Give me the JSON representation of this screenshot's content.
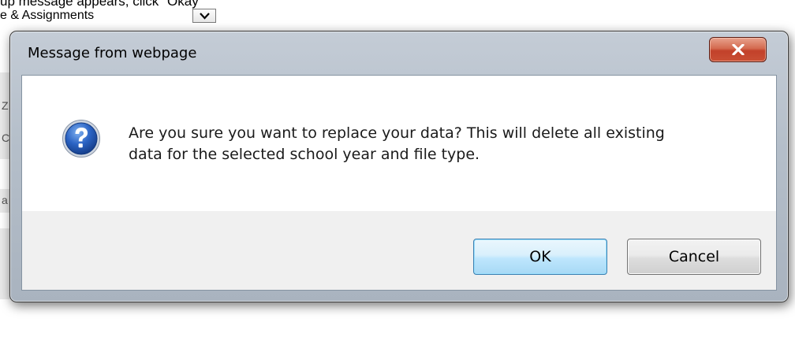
{
  "background": {
    "instruction_fragment": "up message appears, click \"Okay\"",
    "select_fragment": "e & Assignments",
    "strip_fragments": [
      "",
      "Z",
      "C",
      "a"
    ]
  },
  "dialog": {
    "title": "Message from webpage",
    "icon": "question-icon",
    "message_line_1": "Are you sure you want to replace your data? This will delete all existing",
    "message_line_2": "data for the selected school year and file type.",
    "ok_label": "OK",
    "cancel_label": "Cancel",
    "close_glyph": "x"
  },
  "colors": {
    "close_button": "#c94f34",
    "default_button_border": "#3c7fb1",
    "button_area": "#f0f0f0",
    "icon_blue": "#1e4fa3"
  }
}
